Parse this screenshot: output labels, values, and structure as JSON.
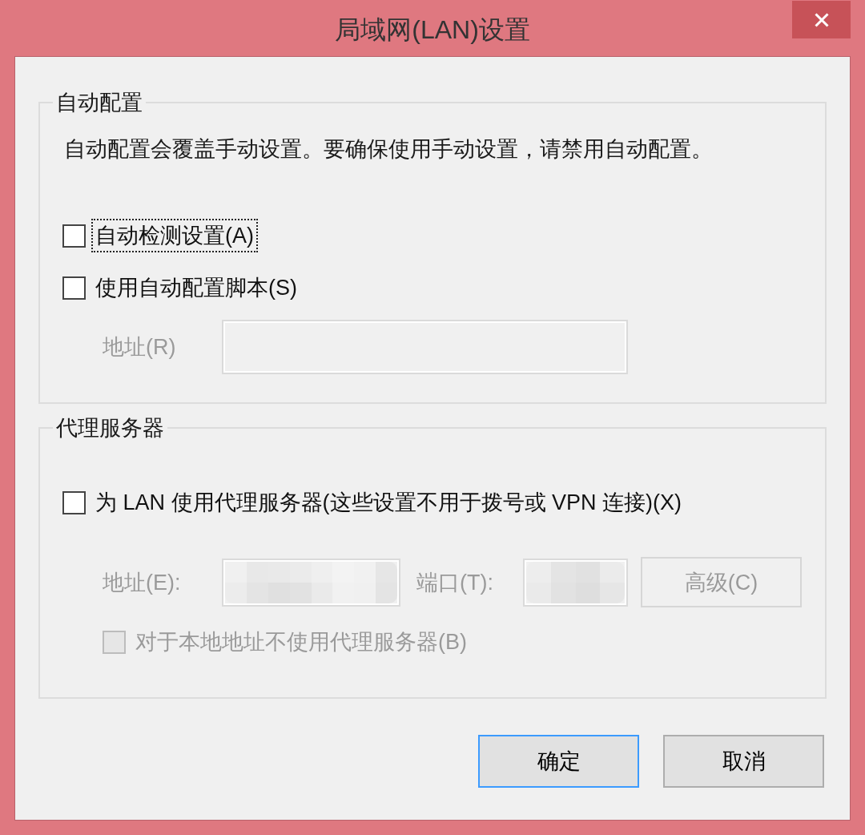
{
  "window": {
    "title": "局域网(LAN)设置"
  },
  "auto_config": {
    "legend": "自动配置",
    "description": "自动配置会覆盖手动设置。要确保使用手动设置，请禁用自动配置。",
    "options": [
      {
        "label": "自动检测设置(A)",
        "checked": false,
        "focused": true,
        "disabled": false
      },
      {
        "label": "使用自动配置脚本(S)",
        "checked": false,
        "focused": false,
        "disabled": false
      }
    ],
    "script_address": {
      "label": "地址(R)",
      "disabled": true
    }
  },
  "proxy_server": {
    "legend": "代理服务器",
    "use_proxy": {
      "label": "为 LAN 使用代理服务器(这些设置不用于拨号或 VPN 连接)(X)",
      "checked": false,
      "disabled": false
    },
    "address": {
      "label": "地址(E):",
      "disabled": true,
      "redacted": true
    },
    "port": {
      "label": "端口(T):",
      "disabled": true,
      "redacted": true
    },
    "advanced_button": {
      "label": "高级(C)",
      "disabled": true
    },
    "bypass_local": {
      "label": "对于本地地址不使用代理服务器(B)",
      "checked": false,
      "disabled": true
    }
  },
  "buttons": [
    {
      "label": "确定",
      "default": true
    },
    {
      "label": "取消",
      "default": false
    }
  ]
}
